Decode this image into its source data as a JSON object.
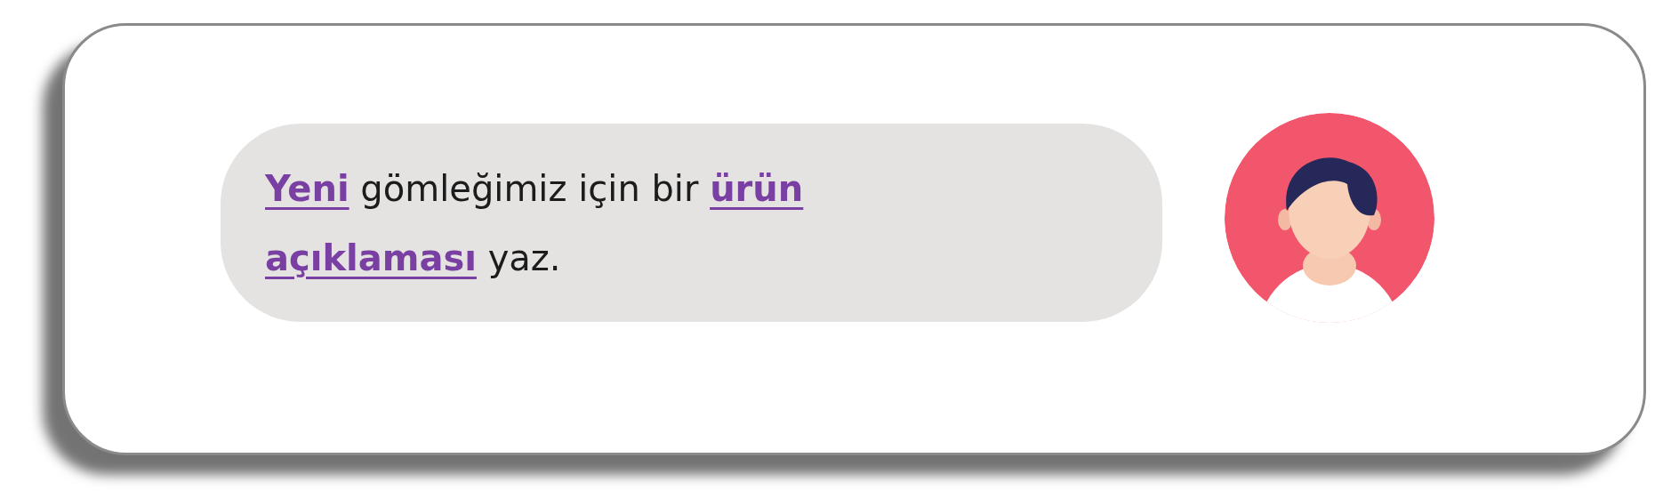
{
  "message": {
    "text": "**Yeni** gömleğimiz için bir **ürün** **açıklaması** yaz."
  }
}
